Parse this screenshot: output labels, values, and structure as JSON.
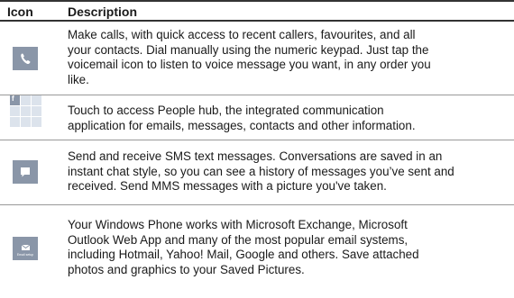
{
  "table": {
    "headers": {
      "icon": "Icon",
      "description": "Description"
    },
    "rows": [
      {
        "icon": "phone-icon",
        "description": "Make calls, with quick access to recent callers, favourites, and all\nyour contacts. Dial manually using the numeric keypad. Just tap the\nvoicemail icon to listen to voice message you want, in any order you\nlike."
      },
      {
        "icon": "people-hub-icon",
        "icon_text": "f",
        "description": "Touch to access People hub, the integrated communication\napplication for emails, messages, contacts and other information."
      },
      {
        "icon": "messaging-icon",
        "description": "Send and receive SMS text messages. Conversations are saved in an\ninstant chat style, so you can see a history of messages you’ve sent and\nreceived. Send MMS messages with a picture you've taken."
      },
      {
        "icon": "email-icon",
        "icon_text": "Email setup",
        "description": "Your Windows Phone works with Microsoft Exchange, Microsoft\nOutlook Web App and many of the most popular email systems,\nincluding Hotmail, Yahoo! Mail, Google and others. Save attached\nphotos and graphics to your Saved Pictures."
      }
    ]
  },
  "colors": {
    "tile": "#8a96a8",
    "tile_light": "#dce3ec",
    "rule": "#333333",
    "divider": "#999999"
  }
}
